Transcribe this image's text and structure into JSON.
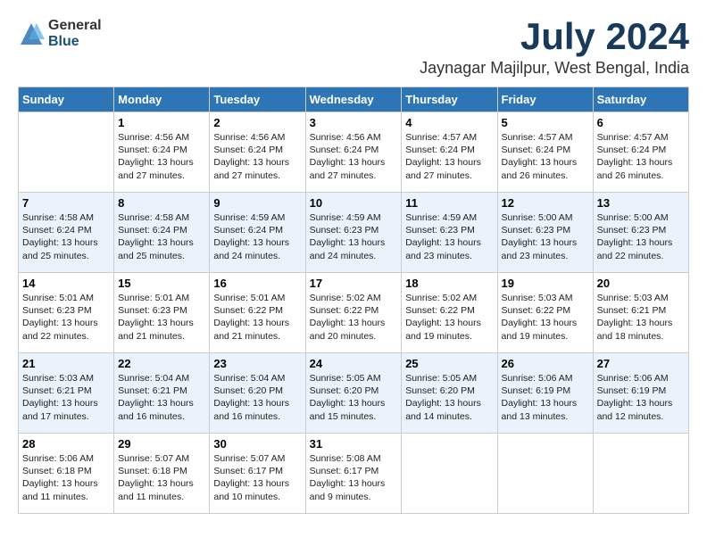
{
  "header": {
    "logo_general": "General",
    "logo_blue": "Blue",
    "month_title": "July 2024",
    "location": "Jaynagar Majilpur, West Bengal, India"
  },
  "calendar": {
    "days_of_week": [
      "Sunday",
      "Monday",
      "Tuesday",
      "Wednesday",
      "Thursday",
      "Friday",
      "Saturday"
    ],
    "weeks": [
      [
        {
          "day": "",
          "sunrise": "",
          "sunset": "",
          "daylight": ""
        },
        {
          "day": "1",
          "sunrise": "Sunrise: 4:56 AM",
          "sunset": "Sunset: 6:24 PM",
          "daylight": "Daylight: 13 hours and 27 minutes."
        },
        {
          "day": "2",
          "sunrise": "Sunrise: 4:56 AM",
          "sunset": "Sunset: 6:24 PM",
          "daylight": "Daylight: 13 hours and 27 minutes."
        },
        {
          "day": "3",
          "sunrise": "Sunrise: 4:56 AM",
          "sunset": "Sunset: 6:24 PM",
          "daylight": "Daylight: 13 hours and 27 minutes."
        },
        {
          "day": "4",
          "sunrise": "Sunrise: 4:57 AM",
          "sunset": "Sunset: 6:24 PM",
          "daylight": "Daylight: 13 hours and 27 minutes."
        },
        {
          "day": "5",
          "sunrise": "Sunrise: 4:57 AM",
          "sunset": "Sunset: 6:24 PM",
          "daylight": "Daylight: 13 hours and 26 minutes."
        },
        {
          "day": "6",
          "sunrise": "Sunrise: 4:57 AM",
          "sunset": "Sunset: 6:24 PM",
          "daylight": "Daylight: 13 hours and 26 minutes."
        }
      ],
      [
        {
          "day": "7",
          "sunrise": "Sunrise: 4:58 AM",
          "sunset": "Sunset: 6:24 PM",
          "daylight": "Daylight: 13 hours and 25 minutes."
        },
        {
          "day": "8",
          "sunrise": "Sunrise: 4:58 AM",
          "sunset": "Sunset: 6:24 PM",
          "daylight": "Daylight: 13 hours and 25 minutes."
        },
        {
          "day": "9",
          "sunrise": "Sunrise: 4:59 AM",
          "sunset": "Sunset: 6:24 PM",
          "daylight": "Daylight: 13 hours and 24 minutes."
        },
        {
          "day": "10",
          "sunrise": "Sunrise: 4:59 AM",
          "sunset": "Sunset: 6:23 PM",
          "daylight": "Daylight: 13 hours and 24 minutes."
        },
        {
          "day": "11",
          "sunrise": "Sunrise: 4:59 AM",
          "sunset": "Sunset: 6:23 PM",
          "daylight": "Daylight: 13 hours and 23 minutes."
        },
        {
          "day": "12",
          "sunrise": "Sunrise: 5:00 AM",
          "sunset": "Sunset: 6:23 PM",
          "daylight": "Daylight: 13 hours and 23 minutes."
        },
        {
          "day": "13",
          "sunrise": "Sunrise: 5:00 AM",
          "sunset": "Sunset: 6:23 PM",
          "daylight": "Daylight: 13 hours and 22 minutes."
        }
      ],
      [
        {
          "day": "14",
          "sunrise": "Sunrise: 5:01 AM",
          "sunset": "Sunset: 6:23 PM",
          "daylight": "Daylight: 13 hours and 22 minutes."
        },
        {
          "day": "15",
          "sunrise": "Sunrise: 5:01 AM",
          "sunset": "Sunset: 6:23 PM",
          "daylight": "Daylight: 13 hours and 21 minutes."
        },
        {
          "day": "16",
          "sunrise": "Sunrise: 5:01 AM",
          "sunset": "Sunset: 6:22 PM",
          "daylight": "Daylight: 13 hours and 21 minutes."
        },
        {
          "day": "17",
          "sunrise": "Sunrise: 5:02 AM",
          "sunset": "Sunset: 6:22 PM",
          "daylight": "Daylight: 13 hours and 20 minutes."
        },
        {
          "day": "18",
          "sunrise": "Sunrise: 5:02 AM",
          "sunset": "Sunset: 6:22 PM",
          "daylight": "Daylight: 13 hours and 19 minutes."
        },
        {
          "day": "19",
          "sunrise": "Sunrise: 5:03 AM",
          "sunset": "Sunset: 6:22 PM",
          "daylight": "Daylight: 13 hours and 19 minutes."
        },
        {
          "day": "20",
          "sunrise": "Sunrise: 5:03 AM",
          "sunset": "Sunset: 6:21 PM",
          "daylight": "Daylight: 13 hours and 18 minutes."
        }
      ],
      [
        {
          "day": "21",
          "sunrise": "Sunrise: 5:03 AM",
          "sunset": "Sunset: 6:21 PM",
          "daylight": "Daylight: 13 hours and 17 minutes."
        },
        {
          "day": "22",
          "sunrise": "Sunrise: 5:04 AM",
          "sunset": "Sunset: 6:21 PM",
          "daylight": "Daylight: 13 hours and 16 minutes."
        },
        {
          "day": "23",
          "sunrise": "Sunrise: 5:04 AM",
          "sunset": "Sunset: 6:20 PM",
          "daylight": "Daylight: 13 hours and 16 minutes."
        },
        {
          "day": "24",
          "sunrise": "Sunrise: 5:05 AM",
          "sunset": "Sunset: 6:20 PM",
          "daylight": "Daylight: 13 hours and 15 minutes."
        },
        {
          "day": "25",
          "sunrise": "Sunrise: 5:05 AM",
          "sunset": "Sunset: 6:20 PM",
          "daylight": "Daylight: 13 hours and 14 minutes."
        },
        {
          "day": "26",
          "sunrise": "Sunrise: 5:06 AM",
          "sunset": "Sunset: 6:19 PM",
          "daylight": "Daylight: 13 hours and 13 minutes."
        },
        {
          "day": "27",
          "sunrise": "Sunrise: 5:06 AM",
          "sunset": "Sunset: 6:19 PM",
          "daylight": "Daylight: 13 hours and 12 minutes."
        }
      ],
      [
        {
          "day": "28",
          "sunrise": "Sunrise: 5:06 AM",
          "sunset": "Sunset: 6:18 PM",
          "daylight": "Daylight: 13 hours and 11 minutes."
        },
        {
          "day": "29",
          "sunrise": "Sunrise: 5:07 AM",
          "sunset": "Sunset: 6:18 PM",
          "daylight": "Daylight: 13 hours and 11 minutes."
        },
        {
          "day": "30",
          "sunrise": "Sunrise: 5:07 AM",
          "sunset": "Sunset: 6:17 PM",
          "daylight": "Daylight: 13 hours and 10 minutes."
        },
        {
          "day": "31",
          "sunrise": "Sunrise: 5:08 AM",
          "sunset": "Sunset: 6:17 PM",
          "daylight": "Daylight: 13 hours and 9 minutes."
        },
        {
          "day": "",
          "sunrise": "",
          "sunset": "",
          "daylight": ""
        },
        {
          "day": "",
          "sunrise": "",
          "sunset": "",
          "daylight": ""
        },
        {
          "day": "",
          "sunrise": "",
          "sunset": "",
          "daylight": ""
        }
      ]
    ]
  }
}
